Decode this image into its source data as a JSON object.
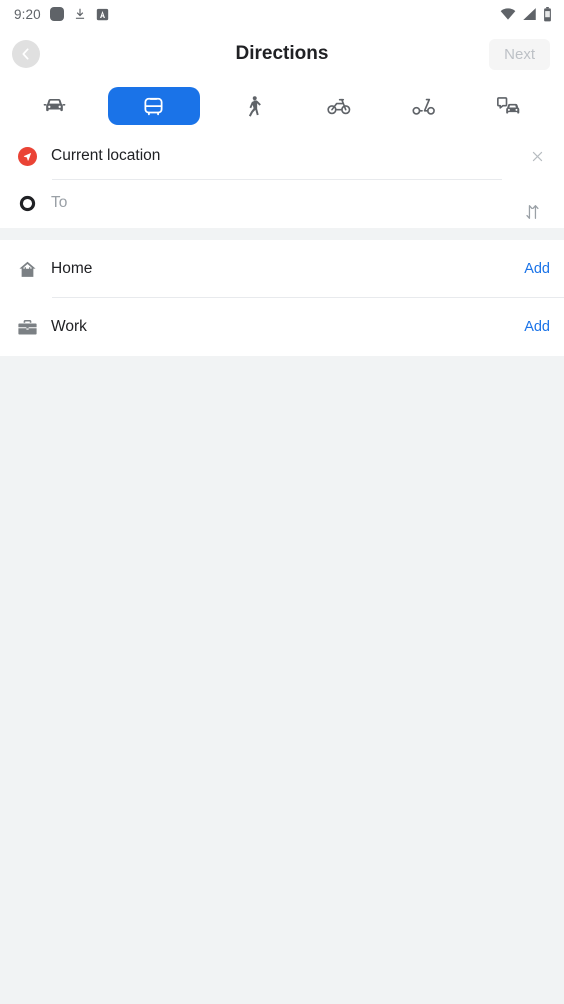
{
  "statusbar": {
    "time": "9:20",
    "left_icons": [
      "rounded-square-icon",
      "download-icon",
      "a-box-icon"
    ],
    "right_icons": [
      "wifi-icon",
      "signal-icon",
      "battery-icon"
    ]
  },
  "header": {
    "back_icon": "chevron-left-icon",
    "title": "Directions",
    "next_label": "Next",
    "next_enabled": false
  },
  "travel_modes": [
    {
      "id": "driving",
      "icon": "car-icon",
      "selected": false
    },
    {
      "id": "transit",
      "icon": "bus-icon",
      "selected": true
    },
    {
      "id": "walking",
      "icon": "walk-icon",
      "selected": false
    },
    {
      "id": "cycling",
      "icon": "bicycle-icon",
      "selected": false
    },
    {
      "id": "scooter",
      "icon": "scooter-icon",
      "selected": false
    },
    {
      "id": "rideshare",
      "icon": "rideshare-icon",
      "selected": false
    }
  ],
  "route_inputs": {
    "origin": {
      "icon": "navigation-arrow-icon",
      "value": "Current location",
      "clear_icon": "close-icon"
    },
    "destination": {
      "icon": "destination-ring-icon",
      "value": "",
      "placeholder": "To"
    },
    "swap_icon": "swap-vertical-icon"
  },
  "shortcuts": [
    {
      "icon": "home-icon",
      "label": "Home",
      "action": "Add"
    },
    {
      "icon": "briefcase-icon",
      "label": "Work",
      "action": "Add"
    }
  ],
  "colors": {
    "accent_blue": "#1a73e8",
    "origin_red": "#ea4335",
    "text_primary": "#202124",
    "text_muted": "#9aa0a6",
    "surface": "#ffffff",
    "background": "#f1f3f4"
  }
}
